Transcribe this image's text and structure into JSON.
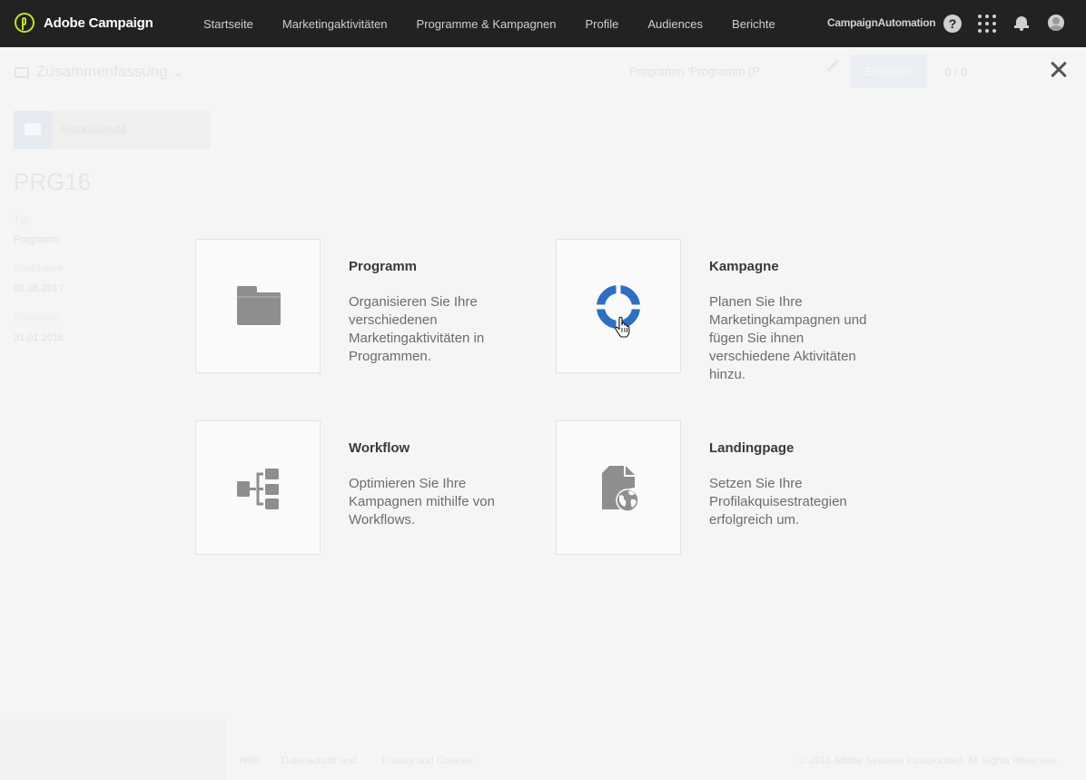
{
  "header": {
    "brand": "Adobe Campaign",
    "nav": [
      "Startseite",
      "Marketingaktivitäten",
      "Programme & Kampagnen",
      "Profile",
      "Audiences",
      "Berichte"
    ],
    "org": "CampaignAutomation",
    "help_glyph": "?"
  },
  "background": {
    "summary_label": "Zusammenfassung",
    "program_name": "Programm 'Programm (P",
    "create_label": "Erstellen",
    "count": "0 / 0",
    "type_tag": "PROGRAMM",
    "code": "PRG16",
    "fields": [
      {
        "label": "Typ",
        "value": "Programm"
      },
      {
        "label": "Startdatum",
        "value": "02.08.2017"
      },
      {
        "label": "Enddatum",
        "value": "31.01.2018"
      }
    ],
    "footer_links": [
      "Hilfe",
      "Datenschutz und",
      "Privacy und Cookies"
    ],
    "copyright": "© 2018 Adobe Systems Incorporated. All Rights Reserved."
  },
  "modal": {
    "options": [
      {
        "title": "Programm",
        "description": "Organisieren Sie Ihre verschiedenen Marketingaktivitäten in Programmen."
      },
      {
        "title": "Kampagne",
        "description": "Planen Sie Ihre Marketingkampagnen und fügen Sie ihnen verschiedene Aktivitäten hinzu."
      },
      {
        "title": "Workflow",
        "description": "Optimieren Sie Ihre Kampagnen mithilfe von Workflows."
      },
      {
        "title": "Landingpage",
        "description": "Setzen Sie Ihre Profilakquisestrategien erfolgreich um."
      }
    ]
  },
  "colors": {
    "topbar": "#222222",
    "brand_accent": "#c6e02a",
    "icon_gray": "#8e8e8e",
    "campaign_blue": "#2f6fc2"
  },
  "icons": [
    "folder-icon",
    "target-icon",
    "workflow-icon",
    "landing-page-icon",
    "close-icon",
    "help-icon",
    "apps-grid-icon",
    "bell-icon",
    "avatar-icon",
    "hand-cursor-icon"
  ]
}
